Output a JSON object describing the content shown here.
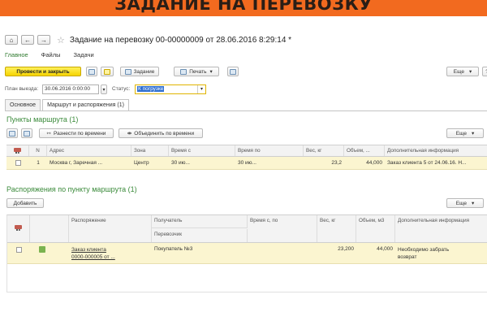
{
  "banner": {
    "text": "ЗАДАНИЕ НА ПЕРЕВОЗКУ"
  },
  "window": {
    "title": "Задание на перевозку 00-00000009 от 28.06.2016 8:29:14 *",
    "nav": {
      "home": "⌂",
      "back": "←",
      "forward": "→",
      "star": "☆"
    }
  },
  "sections": [
    "Главное",
    "Файлы",
    "Задачи"
  ],
  "toolbar": {
    "post_close": "Провести и закрыть",
    "task": "Задание",
    "print": "Печать",
    "more": "Еще",
    "help": "?"
  },
  "fields": {
    "plan_label": "План выезда:",
    "plan_value": "30.06.2016  0:00:00",
    "status_label": "Статус:",
    "status_value": "К погрузке"
  },
  "tabs": [
    "Основное",
    "Маршрут и распоряжения (1)"
  ],
  "route_points": {
    "title": "Пункты маршрута (1)",
    "distribute_time": "Разнести по времени",
    "merge_time": "Объединить по времени",
    "more": "Еще",
    "columns": [
      "N",
      "Адрес",
      "Зона",
      "Время с",
      "Время по",
      "Вес, кг",
      "Объем, ...",
      "Дополнительная информация"
    ],
    "rows": [
      {
        "n": "1",
        "address": "Москва г, Заречная ...",
        "zone": "Центр",
        "time_from": "30 ию...",
        "time_to": "30 ию...",
        "weight": "23,2",
        "volume": "44,000",
        "info": "Заказ клиента 5 от 24.06.16. Н..."
      }
    ]
  },
  "orders": {
    "title": "Распоряжения по пункту маршрута (1)",
    "add": "Добавить",
    "more": "Еще",
    "columns": [
      "Распоряжение",
      "Получатель",
      "Перевозчик",
      "Время с, по",
      "Вес, кг",
      "Объем, м3",
      "Дополнительная информация"
    ],
    "rows": [
      {
        "order_line1": "Заказ клиента",
        "order_line2": "0000-000005 от ...",
        "recipient": "Покупатель №3",
        "weight": "23,200",
        "volume": "44,000",
        "info_line1": "Необходимо забрать",
        "info_line2": "возврат"
      }
    ]
  }
}
